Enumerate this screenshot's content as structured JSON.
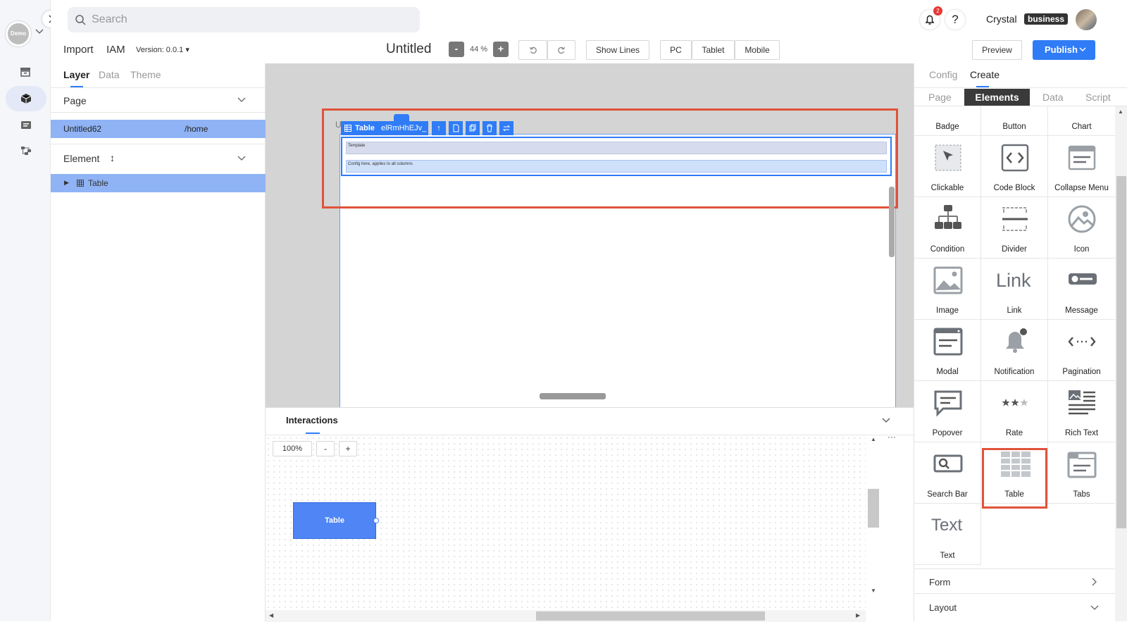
{
  "topbar": {
    "search_placeholder": "Search",
    "user_name": "Crystal",
    "plan_badge": "business",
    "notif_count": "2",
    "workspace": "Demo"
  },
  "toolbar": {
    "import": "Import",
    "project": "IAM",
    "version": "Version: 0.0.1",
    "title": "Untitled",
    "zoom_minus": "-",
    "zoom": "44 %",
    "zoom_plus": "+",
    "show_lines": "Show Lines",
    "device_pc": "PC",
    "device_tablet": "Tablet",
    "device_mobile": "Mobile",
    "preview": "Preview",
    "publish": "Publish"
  },
  "left": {
    "tabs": [
      "Layer",
      "Data",
      "Theme"
    ],
    "page_header": "Page",
    "page_name": "Untitled62",
    "page_path": "/home",
    "element_header": "Element",
    "tree_item": "Table"
  },
  "canvas": {
    "selected_type": "Table",
    "selected_id": "elRmHhEJv_",
    "row_template": "Template",
    "row_config": "Config here, applies to all columns",
    "partial_label": "U"
  },
  "interactions": {
    "title": "Interactions",
    "zoom": "100%",
    "zoom_minus": "-",
    "zoom_plus": "+",
    "node_label": "Table",
    "more": "···"
  },
  "right": {
    "tabs": [
      "Config",
      "Create"
    ],
    "subtabs": [
      "Page",
      "Elements",
      "Data",
      "Script"
    ],
    "elements": [
      "Badge",
      "Button",
      "Chart",
      "Clickable",
      "Code Block",
      "Collapse Menu",
      "Condition",
      "Divider",
      "Icon",
      "Image",
      "Link",
      "Message",
      "Modal",
      "Notification",
      "Pagination",
      "Popover",
      "Rate",
      "Rich Text",
      "Search Bar",
      "Table",
      "Tabs",
      "Text"
    ],
    "section_form": "Form",
    "section_layout": "Layout",
    "link_icon_text": "Link",
    "text_icon_text": "Text"
  },
  "colors": {
    "primary": "#2f7cf6",
    "highlight": "#e0533a",
    "selected_row": "#8fb3f5",
    "dark_tab": "#3a3a3a"
  }
}
